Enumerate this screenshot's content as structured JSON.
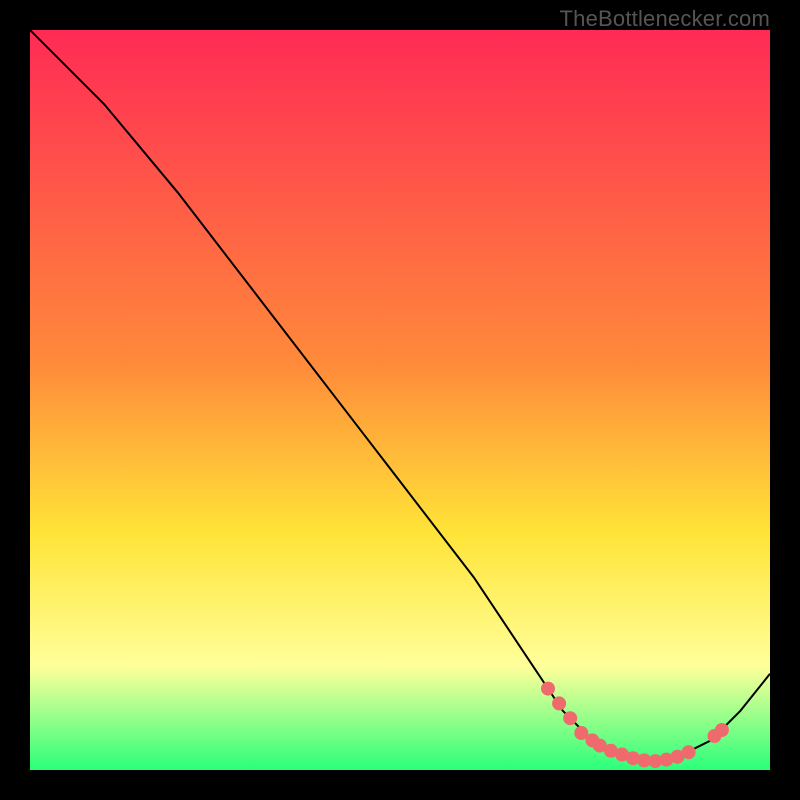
{
  "watermark": "TheBottlenecker.com",
  "colors": {
    "marker": "#ef6a6d",
    "curve": "#000000",
    "gradient_top": "#ff2a55",
    "gradient_mid1": "#ff8a3a",
    "gradient_mid2": "#ffe438",
    "gradient_mid3": "#ffff9a",
    "gradient_bottom": "#2aff7a"
  },
  "chart_data": {
    "type": "line",
    "title": "",
    "xlabel": "",
    "ylabel": "",
    "xlim": [
      0,
      100
    ],
    "ylim": [
      0,
      100
    ],
    "curve": [
      {
        "x": 0,
        "y": 100
      },
      {
        "x": 6,
        "y": 94
      },
      {
        "x": 10,
        "y": 90
      },
      {
        "x": 20,
        "y": 78
      },
      {
        "x": 30,
        "y": 65
      },
      {
        "x": 40,
        "y": 52
      },
      {
        "x": 50,
        "y": 39
      },
      {
        "x": 60,
        "y": 26
      },
      {
        "x": 68,
        "y": 14
      },
      {
        "x": 72,
        "y": 8
      },
      {
        "x": 76,
        "y": 4
      },
      {
        "x": 80,
        "y": 2
      },
      {
        "x": 84,
        "y": 1
      },
      {
        "x": 88,
        "y": 2
      },
      {
        "x": 92,
        "y": 4
      },
      {
        "x": 96,
        "y": 8
      },
      {
        "x": 100,
        "y": 13
      }
    ],
    "markers": [
      {
        "x": 70,
        "y": 11
      },
      {
        "x": 71.5,
        "y": 9
      },
      {
        "x": 73,
        "y": 7
      },
      {
        "x": 74.5,
        "y": 5
      },
      {
        "x": 76,
        "y": 4
      },
      {
        "x": 77,
        "y": 3.3
      },
      {
        "x": 78.5,
        "y": 2.6
      },
      {
        "x": 80,
        "y": 2.1
      },
      {
        "x": 81.5,
        "y": 1.6
      },
      {
        "x": 83,
        "y": 1.3
      },
      {
        "x": 84.5,
        "y": 1.2
      },
      {
        "x": 86,
        "y": 1.4
      },
      {
        "x": 87.5,
        "y": 1.8
      },
      {
        "x": 89,
        "y": 2.4
      },
      {
        "x": 92.5,
        "y": 4.6
      },
      {
        "x": 93.5,
        "y": 5.4
      }
    ],
    "gradient_bands": [
      {
        "stop": 0,
        "color": "gradient_top"
      },
      {
        "stop": 0.45,
        "color": "gradient_mid1"
      },
      {
        "stop": 0.68,
        "color": "gradient_mid2"
      },
      {
        "stop": 0.86,
        "color": "gradient_mid3"
      },
      {
        "stop": 1.0,
        "color": "gradient_bottom"
      }
    ]
  }
}
